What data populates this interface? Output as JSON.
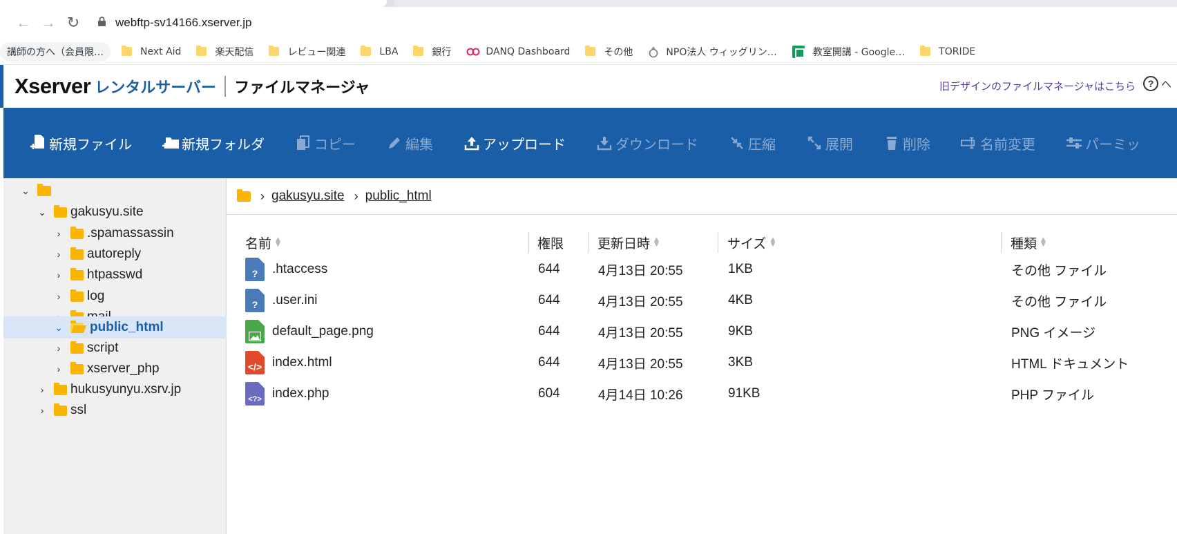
{
  "browser": {
    "url": "webftp-sv14166.xserver.jp",
    "bookmarks": [
      "講師の方へ（会員限…",
      "Next Aid",
      "楽天配信",
      "レビュー関連",
      "LBA",
      "銀行",
      "DANQ Dashboard",
      "その他",
      "NPO法人 ウィッグリン…",
      "教室開講 - Google…",
      "TORIDE"
    ]
  },
  "header": {
    "brand_main": "Xserver",
    "brand_sub": "レンタルサーバー",
    "app_title": "ファイルマネージャ",
    "old_design_link": "旧デザインのファイルマネージャはこちら",
    "help_label": "ヘ"
  },
  "toolbar": {
    "new_file": "新規ファイル",
    "new_folder": "新規フォルダ",
    "copy": "コピー",
    "edit": "編集",
    "upload": "アップロード",
    "download": "ダウンロード",
    "compress": "圧縮",
    "extract": "展開",
    "delete": "削除",
    "rename": "名前変更",
    "permission": "パーミッ"
  },
  "tree": {
    "items": [
      {
        "label": "gakusyu.site"
      },
      {
        "label": ".spamassassin"
      },
      {
        "label": "autoreply"
      },
      {
        "label": "htpasswd"
      },
      {
        "label": "log"
      },
      {
        "label": "mail"
      },
      {
        "label": "public_html"
      },
      {
        "label": "script"
      },
      {
        "label": "xserver_php"
      },
      {
        "label": "hukusyunyu.xsrv.jp"
      },
      {
        "label": "ssl"
      }
    ]
  },
  "breadcrumb": {
    "items": [
      "gakusyu.site",
      "public_html"
    ]
  },
  "table": {
    "headers": {
      "name": "名前",
      "perm": "権限",
      "date": "更新日時",
      "size": "サイズ",
      "type": "種類"
    },
    "rows": [
      {
        "icon": "unknown-file-icon",
        "name": ".htaccess",
        "perm": "644",
        "date": "4月13日 20:55",
        "size": "1KB",
        "type": "その他 ファイル"
      },
      {
        "icon": "unknown-file-icon",
        "name": ".user.ini",
        "perm": "644",
        "date": "4月13日 20:55",
        "size": "4KB",
        "type": "その他 ファイル"
      },
      {
        "icon": "image-file-icon",
        "name": "default_page.png",
        "perm": "644",
        "date": "4月13日 20:55",
        "size": "9KB",
        "type": "PNG イメージ"
      },
      {
        "icon": "html-file-icon",
        "name": "index.html",
        "perm": "644",
        "date": "4月13日 20:55",
        "size": "3KB",
        "type": "HTML ドキュメント"
      },
      {
        "icon": "php-file-icon",
        "name": "index.php",
        "perm": "604",
        "date": "4月14日 10:26",
        "size": "91KB",
        "type": "PHP ファイル"
      }
    ]
  }
}
